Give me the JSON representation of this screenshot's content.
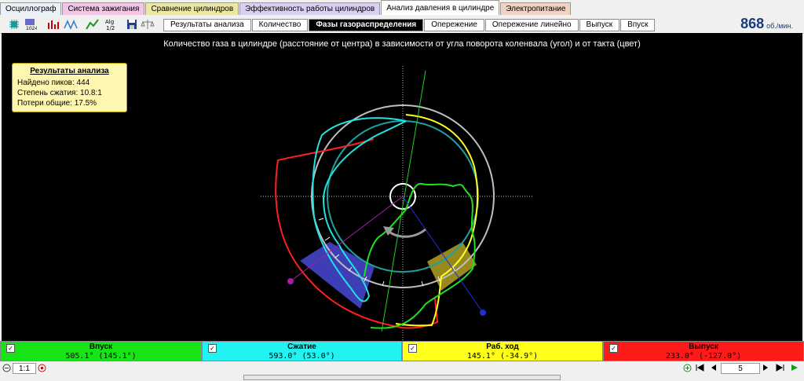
{
  "tabs": [
    {
      "label": "Осциллограф",
      "color": "#e9f0f7"
    },
    {
      "label": "Система зажигания",
      "color": "#f2c7e6"
    },
    {
      "label": "Сравнение цилиндров",
      "color": "#ebe7a6"
    },
    {
      "label": "Эффективность работы цилиндров",
      "color": "#d9cff0"
    },
    {
      "label": "Анализ давления в цилиндре",
      "color": "#ffffff"
    },
    {
      "label": "Электропитание",
      "color": "#f2d2c4"
    }
  ],
  "subtabs": [
    "Результаты анализа",
    "Количество",
    "Фазы газораспределения",
    "Опережение",
    "Опережение линейно",
    "Выпуск",
    "Впуск"
  ],
  "active_subtab": "Фазы газораспределения",
  "rpm": {
    "value": "868",
    "unit": "об./мин."
  },
  "chart_title": "Количество газа в цилиндре (расстояние от центра) в зависимости от угла поворота коленвала (угол) и от такта (цвет)",
  "results": {
    "title": "Результаты анализа",
    "peaks": "Найдено пиков: 444",
    "compression": "Степень сжатия: 10.8:1",
    "losses": "Потери общие: 17.5%"
  },
  "legend": [
    {
      "name": "Впуск",
      "value": "505.1° (145.1°)",
      "color": "#17e317"
    },
    {
      "name": "Сжатие",
      "value": "593.0° (53.0°)",
      "color": "#22f2f2"
    },
    {
      "name": "Раб. ход",
      "value": "145.1° (-34.9°)",
      "color": "#ffff1a"
    },
    {
      "name": "Выпуск",
      "value": "233.0° (-127.0°)",
      "color": "#ff1a1a"
    }
  ],
  "status": {
    "zoom": "1:1",
    "page": "5"
  },
  "icons": [
    "chip-icon",
    "counter-icon",
    "bar-chart-icon",
    "peaks-icon",
    "curve-icon",
    "fraction-icon",
    "save-icon",
    "scale-icon"
  ]
}
